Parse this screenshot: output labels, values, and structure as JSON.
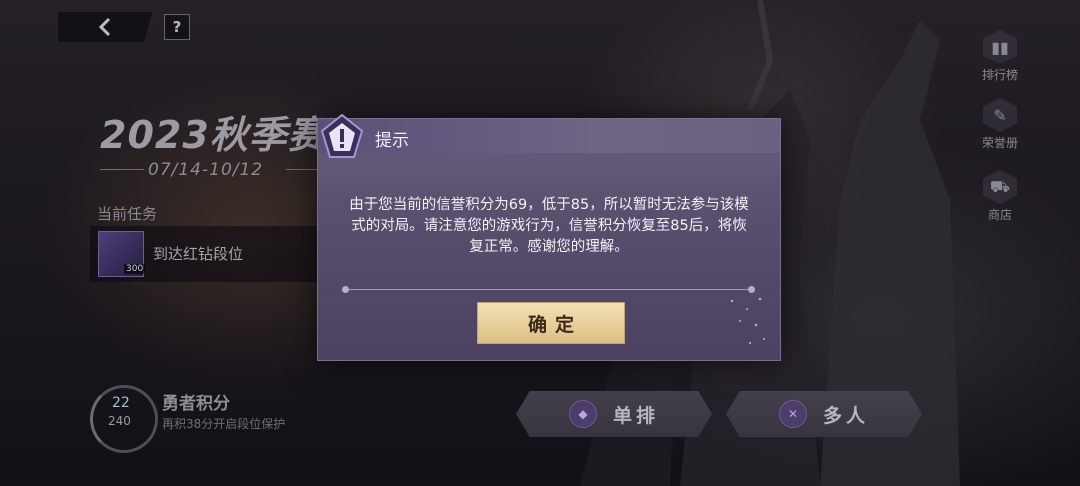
{
  "header": {
    "back_icon": "chevron-left-icon",
    "help_label": "?"
  },
  "season": {
    "title": "2023秋季赛",
    "date_range": "07/14-10/12"
  },
  "task": {
    "section_label": "当前任务",
    "name": "到达红钻段位",
    "badge": "300",
    "icon": "gem-chest-icon"
  },
  "sidebar": {
    "items": [
      {
        "label": "排行榜",
        "icon": "leaderboard-icon"
      },
      {
        "label": "荣誉册",
        "icon": "honor-book-icon"
      },
      {
        "label": "商店",
        "icon": "cart-icon"
      }
    ]
  },
  "score": {
    "title": "勇者积分",
    "current": "22",
    "target": "240",
    "subtitle": "再积38分开启段位保护"
  },
  "modes": {
    "solo": {
      "label": "单排",
      "icon": "solo-queue-icon"
    },
    "multi": {
      "label": "多人",
      "icon": "multi-queue-icon"
    }
  },
  "dialog": {
    "title": "提示",
    "message": "由于您当前的信誉积分为69，低于85，所以暂时无法参与该模式的对局。请注意您的游戏行为，信誉积分恢复至85后，将恢复正常。感谢您的理解。",
    "confirm_label": "确定",
    "icon": "exclamation-icon"
  },
  "colors": {
    "dialog_bg": "#5a5070",
    "confirm_bg": "#f3e0b2",
    "accent_purple": "#6d5c8f"
  }
}
